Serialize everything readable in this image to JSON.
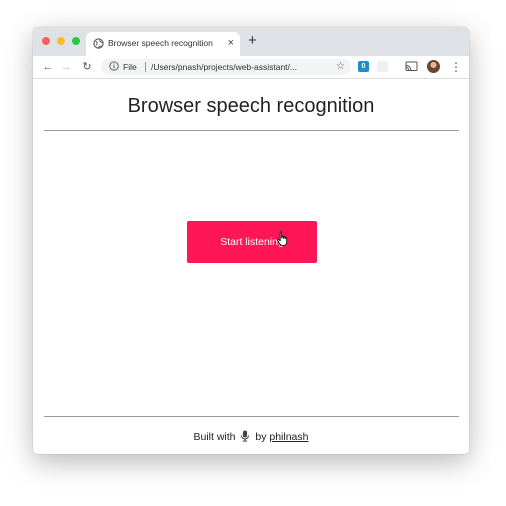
{
  "browser": {
    "tab_title": "Browser speech recognition",
    "tab_close": "×",
    "new_tab": "+",
    "nav": {
      "back": "←",
      "forward": "→",
      "reload": "↻"
    },
    "omnibox": {
      "scheme_label": "File",
      "url": "/Users/pnash/projects/web-assistant/...",
      "star": "☆"
    },
    "extension_label": "0",
    "menu": "⋮"
  },
  "page": {
    "heading": "Browser speech recognition",
    "button_label": "Start listening",
    "footer": {
      "prefix": "Built with",
      "by": "by",
      "author_link": "philnash"
    }
  },
  "colors": {
    "accent": "#ff1654",
    "titlebar": "#dee1e6"
  }
}
